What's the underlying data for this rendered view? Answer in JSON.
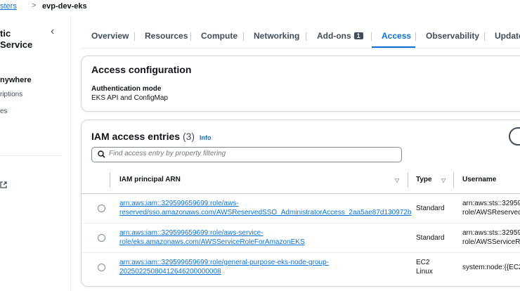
{
  "breadcrumb": {
    "parent": "sters",
    "separator": ">",
    "current": "evp-dev-eks"
  },
  "sidebar": {
    "title_line1": "tic",
    "title_line2": "Service",
    "item1": "nywhere",
    "item2": "riptions",
    "item3": "es"
  },
  "tabs": [
    {
      "label": "Overview"
    },
    {
      "label": "Resources"
    },
    {
      "label": "Compute"
    },
    {
      "label": "Networking"
    },
    {
      "label": "Add-ons",
      "badge": "1"
    },
    {
      "label": "Access",
      "active": true
    },
    {
      "label": "Observability"
    },
    {
      "label": "Update"
    }
  ],
  "access_config": {
    "title": "Access configuration",
    "auth_label": "Authentication mode",
    "auth_value": "EKS API and ConfigMap"
  },
  "iam": {
    "title": "IAM access entries",
    "count": "(3)",
    "info": "Info",
    "search_placeholder": "Find access entry by property filtering",
    "columns": {
      "arn": "IAM principal ARN",
      "type": "Type",
      "username": "Username"
    },
    "rows": [
      {
        "arn_line1": "arn:aws:iam::329599659699:role/aws-",
        "arn_line2": "reserved/sso.amazonaws.com/AWSReservedSSO_AdministratorAccess_2aa5ae87d130972b",
        "type_line1": "Standard",
        "user_line1": "arn:aws:sts::329599",
        "user_line2": "role/AWSReservedS"
      },
      {
        "arn_line1": "arn:aws:iam::329599659699:role/aws-service-",
        "arn_line2": "role/eks.amazonaws.com/AWSServiceRoleForAmazonEKS",
        "type_line1": "Standard",
        "user_line1": "arn:aws:sts::329599",
        "user_line2": "role/AWSServiceRo"
      },
      {
        "arn_line1": "arn:aws:iam::329599659699:role/general-purpose-eks-node-group-",
        "arn_line2": "20250225080412646200000008",
        "type_line1": "EC2",
        "type_line2": "Linux",
        "user_line1": "system:node:{{EC2"
      }
    ]
  },
  "colors": {
    "link": "#0972d3",
    "text": "#0f141a",
    "border": "#c6c6cd"
  }
}
